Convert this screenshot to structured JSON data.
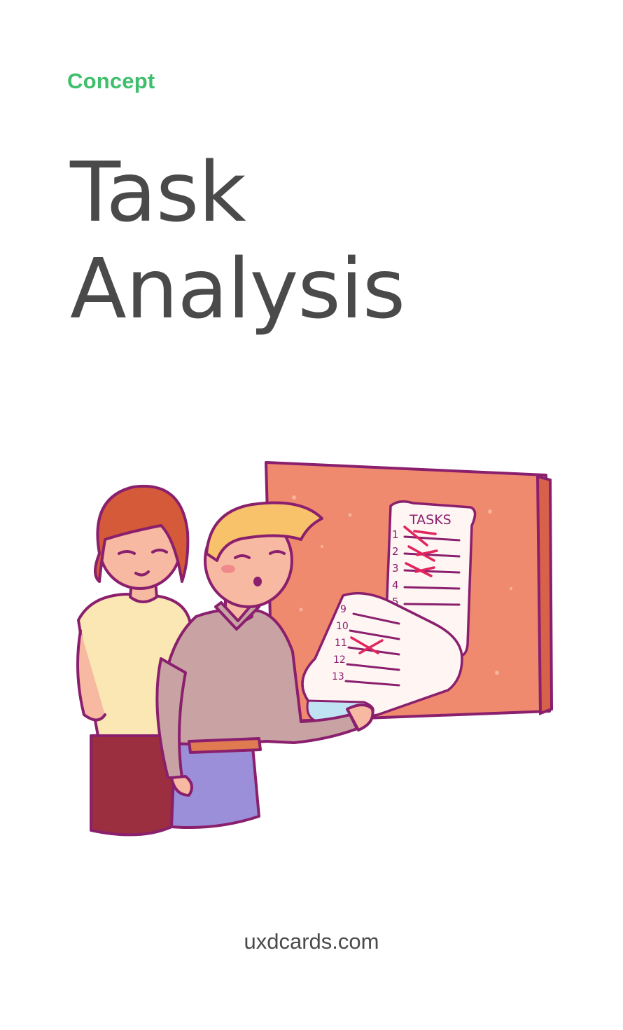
{
  "card": {
    "category": "Concept",
    "title_line1": "Task",
    "title_line2": "Analysis",
    "footer": "uxdcards.com"
  },
  "illustration": {
    "board_heading": "TASKS",
    "list_top": [
      "1",
      "2",
      "3",
      "4",
      "5"
    ],
    "list_bottom": [
      "9",
      "10",
      "11",
      "12",
      "13"
    ]
  },
  "colors": {
    "accent": "#3fbf6c",
    "text": "#4a4a4a",
    "board": "#f08a6e",
    "outline": "#8a1f6e",
    "check": "#e0245e"
  }
}
